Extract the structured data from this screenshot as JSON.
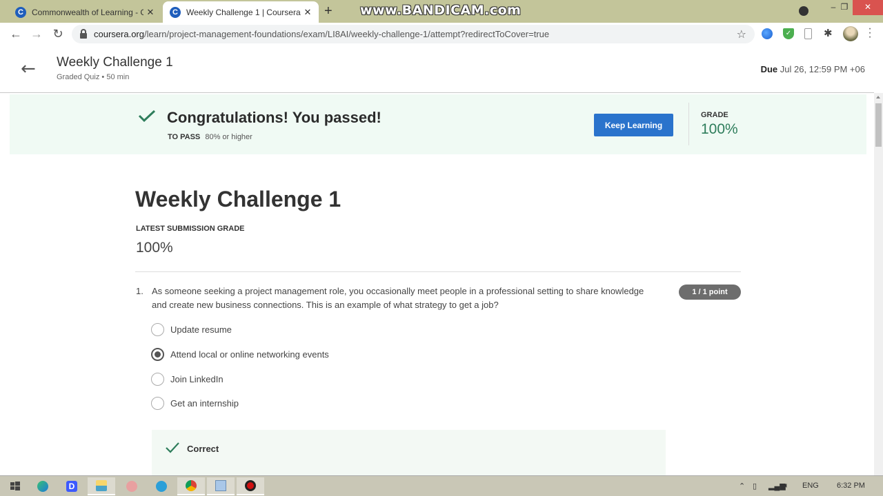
{
  "browser": {
    "tabs": [
      {
        "title": "Commonwealth of Learning - Go",
        "favicon": "C",
        "active": false
      },
      {
        "title": "Weekly Challenge 1 | Coursera",
        "favicon": "C",
        "active": true
      }
    ],
    "new_tab": "+",
    "watermark": "www.BANDICAM.com",
    "url_host": "coursera.org",
    "url_path": "/learn/project-management-foundations/exam/LI8AI/weekly-challenge-1/attempt?redirectToCover=true",
    "window_controls": {
      "minimize": "–",
      "maximize": "❐",
      "close": "✕"
    }
  },
  "header": {
    "title": "Weekly Challenge 1",
    "subtitle": "Graded Quiz • 50 min",
    "due_label": "Due",
    "due_value": "Jul 26, 12:59 PM +06"
  },
  "banner": {
    "title": "Congratulations! You passed!",
    "to_pass_label": "TO PASS",
    "to_pass_value": "80% or higher",
    "button_label": "Keep Learning",
    "grade_label": "GRADE",
    "grade_value": "100%",
    "accent_color": "#2e7d5b",
    "button_color": "#2a73cc"
  },
  "quiz": {
    "title": "Weekly Challenge 1",
    "latest_grade_label": "LATEST SUBMISSION GRADE",
    "latest_grade_value": "100%",
    "questions": [
      {
        "number": "1.",
        "text": "As someone seeking a project management role, you occasionally meet people in a professional setting to share knowledge and create new business connections. This is an example of what strategy to get a job?",
        "points": "1 / 1 point",
        "options": [
          {
            "label": "Update resume",
            "selected": false
          },
          {
            "label": "Attend local or online networking events",
            "selected": true
          },
          {
            "label": "Join LinkedIn",
            "selected": false
          },
          {
            "label": "Get an internship",
            "selected": false
          }
        ],
        "feedback": "Correct"
      }
    ]
  },
  "taskbar": {
    "apps": [
      "windows-start",
      "edge",
      "app-d",
      "file-explorer",
      "paint-app",
      "telegram",
      "chrome",
      "notepad",
      "bandicam-record"
    ],
    "tray": {
      "language": "ENG",
      "time": "6:32 PM"
    }
  }
}
